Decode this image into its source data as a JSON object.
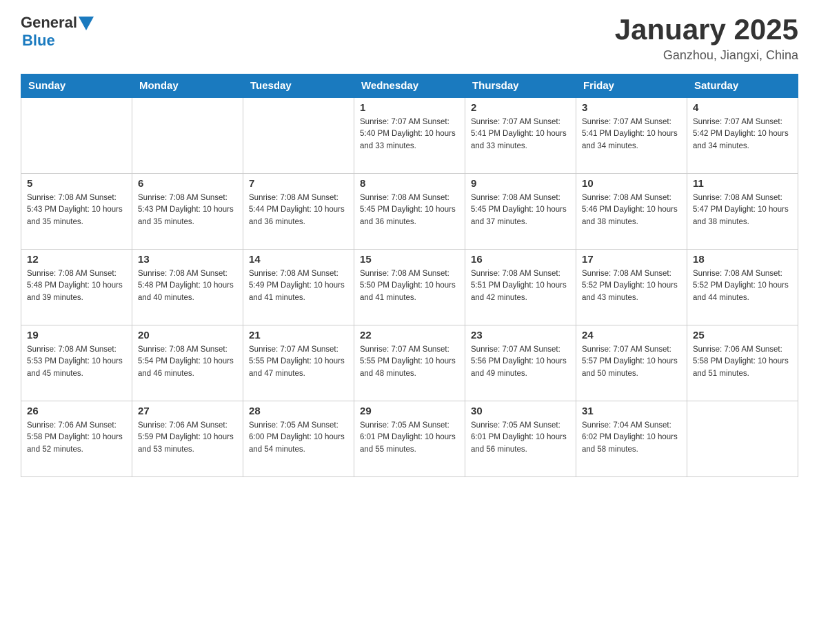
{
  "header": {
    "logo_general": "General",
    "logo_blue": "Blue",
    "title": "January 2025",
    "subtitle": "Ganzhou, Jiangxi, China"
  },
  "days_of_week": [
    "Sunday",
    "Monday",
    "Tuesday",
    "Wednesday",
    "Thursday",
    "Friday",
    "Saturday"
  ],
  "weeks": [
    [
      {
        "day": "",
        "info": ""
      },
      {
        "day": "",
        "info": ""
      },
      {
        "day": "",
        "info": ""
      },
      {
        "day": "1",
        "info": "Sunrise: 7:07 AM\nSunset: 5:40 PM\nDaylight: 10 hours\nand 33 minutes."
      },
      {
        "day": "2",
        "info": "Sunrise: 7:07 AM\nSunset: 5:41 PM\nDaylight: 10 hours\nand 33 minutes."
      },
      {
        "day": "3",
        "info": "Sunrise: 7:07 AM\nSunset: 5:41 PM\nDaylight: 10 hours\nand 34 minutes."
      },
      {
        "day": "4",
        "info": "Sunrise: 7:07 AM\nSunset: 5:42 PM\nDaylight: 10 hours\nand 34 minutes."
      }
    ],
    [
      {
        "day": "5",
        "info": "Sunrise: 7:08 AM\nSunset: 5:43 PM\nDaylight: 10 hours\nand 35 minutes."
      },
      {
        "day": "6",
        "info": "Sunrise: 7:08 AM\nSunset: 5:43 PM\nDaylight: 10 hours\nand 35 minutes."
      },
      {
        "day": "7",
        "info": "Sunrise: 7:08 AM\nSunset: 5:44 PM\nDaylight: 10 hours\nand 36 minutes."
      },
      {
        "day": "8",
        "info": "Sunrise: 7:08 AM\nSunset: 5:45 PM\nDaylight: 10 hours\nand 36 minutes."
      },
      {
        "day": "9",
        "info": "Sunrise: 7:08 AM\nSunset: 5:45 PM\nDaylight: 10 hours\nand 37 minutes."
      },
      {
        "day": "10",
        "info": "Sunrise: 7:08 AM\nSunset: 5:46 PM\nDaylight: 10 hours\nand 38 minutes."
      },
      {
        "day": "11",
        "info": "Sunrise: 7:08 AM\nSunset: 5:47 PM\nDaylight: 10 hours\nand 38 minutes."
      }
    ],
    [
      {
        "day": "12",
        "info": "Sunrise: 7:08 AM\nSunset: 5:48 PM\nDaylight: 10 hours\nand 39 minutes."
      },
      {
        "day": "13",
        "info": "Sunrise: 7:08 AM\nSunset: 5:48 PM\nDaylight: 10 hours\nand 40 minutes."
      },
      {
        "day": "14",
        "info": "Sunrise: 7:08 AM\nSunset: 5:49 PM\nDaylight: 10 hours\nand 41 minutes."
      },
      {
        "day": "15",
        "info": "Sunrise: 7:08 AM\nSunset: 5:50 PM\nDaylight: 10 hours\nand 41 minutes."
      },
      {
        "day": "16",
        "info": "Sunrise: 7:08 AM\nSunset: 5:51 PM\nDaylight: 10 hours\nand 42 minutes."
      },
      {
        "day": "17",
        "info": "Sunrise: 7:08 AM\nSunset: 5:52 PM\nDaylight: 10 hours\nand 43 minutes."
      },
      {
        "day": "18",
        "info": "Sunrise: 7:08 AM\nSunset: 5:52 PM\nDaylight: 10 hours\nand 44 minutes."
      }
    ],
    [
      {
        "day": "19",
        "info": "Sunrise: 7:08 AM\nSunset: 5:53 PM\nDaylight: 10 hours\nand 45 minutes."
      },
      {
        "day": "20",
        "info": "Sunrise: 7:08 AM\nSunset: 5:54 PM\nDaylight: 10 hours\nand 46 minutes."
      },
      {
        "day": "21",
        "info": "Sunrise: 7:07 AM\nSunset: 5:55 PM\nDaylight: 10 hours\nand 47 minutes."
      },
      {
        "day": "22",
        "info": "Sunrise: 7:07 AM\nSunset: 5:55 PM\nDaylight: 10 hours\nand 48 minutes."
      },
      {
        "day": "23",
        "info": "Sunrise: 7:07 AM\nSunset: 5:56 PM\nDaylight: 10 hours\nand 49 minutes."
      },
      {
        "day": "24",
        "info": "Sunrise: 7:07 AM\nSunset: 5:57 PM\nDaylight: 10 hours\nand 50 minutes."
      },
      {
        "day": "25",
        "info": "Sunrise: 7:06 AM\nSunset: 5:58 PM\nDaylight: 10 hours\nand 51 minutes."
      }
    ],
    [
      {
        "day": "26",
        "info": "Sunrise: 7:06 AM\nSunset: 5:58 PM\nDaylight: 10 hours\nand 52 minutes."
      },
      {
        "day": "27",
        "info": "Sunrise: 7:06 AM\nSunset: 5:59 PM\nDaylight: 10 hours\nand 53 minutes."
      },
      {
        "day": "28",
        "info": "Sunrise: 7:05 AM\nSunset: 6:00 PM\nDaylight: 10 hours\nand 54 minutes."
      },
      {
        "day": "29",
        "info": "Sunrise: 7:05 AM\nSunset: 6:01 PM\nDaylight: 10 hours\nand 55 minutes."
      },
      {
        "day": "30",
        "info": "Sunrise: 7:05 AM\nSunset: 6:01 PM\nDaylight: 10 hours\nand 56 minutes."
      },
      {
        "day": "31",
        "info": "Sunrise: 7:04 AM\nSunset: 6:02 PM\nDaylight: 10 hours\nand 58 minutes."
      },
      {
        "day": "",
        "info": ""
      }
    ]
  ]
}
